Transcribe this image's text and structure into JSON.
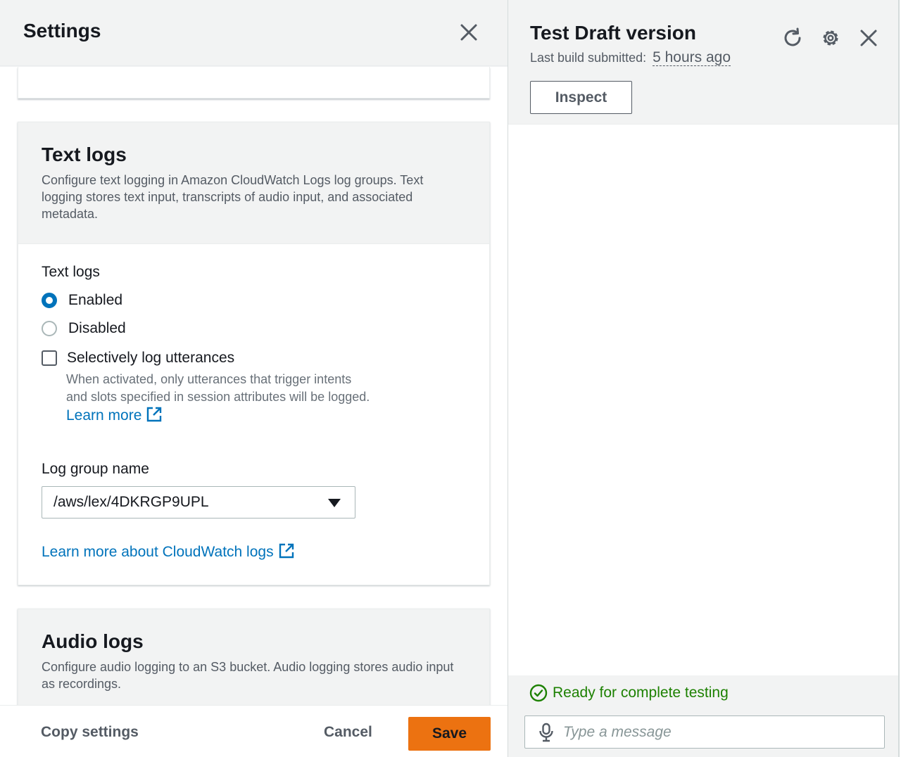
{
  "settings_panel": {
    "title": "Settings",
    "text_logs": {
      "title": "Text logs",
      "description": "Configure text logging in Amazon CloudWatch Logs log groups. Text logging stores text input, transcripts of audio input, and associated metadata.",
      "field_label": "Text logs",
      "options": [
        {
          "label": "Enabled",
          "checked": true
        },
        {
          "label": "Disabled",
          "checked": false
        }
      ],
      "selective_checkbox": {
        "label": "Selectively log utterances",
        "checked": false,
        "help_text": "When activated, only utterances that trigger intents and slots specified in session attributes will be logged.",
        "learn_more": "Learn more"
      },
      "log_group_label": "Log group name",
      "log_group_value": "/aws/lex/4DKRGP9UPL",
      "cloudwatch_link": "Learn more about CloudWatch logs"
    },
    "audio_logs": {
      "title": "Audio logs",
      "description": "Configure audio logging to an S3 bucket. Audio logging stores audio input as recordings."
    },
    "footer": {
      "copy_settings": "Copy settings",
      "cancel": "Cancel",
      "save": "Save"
    }
  },
  "test_panel": {
    "title": "Test Draft version",
    "build_label": "Last build submitted:",
    "build_time": "5 hours ago",
    "inspect": "Inspect",
    "status": "Ready for complete testing",
    "message_placeholder": "Type a message"
  },
  "colors": {
    "accent_blue": "#0073bb",
    "primary_orange": "#ec7211",
    "success_green": "#1d8102",
    "header_gray": "#f2f3f3"
  },
  "icons": [
    "close-icon",
    "external-link-icon",
    "caret-down-icon",
    "refresh-icon",
    "gear-icon",
    "check-circle-icon",
    "microphone-icon"
  ]
}
